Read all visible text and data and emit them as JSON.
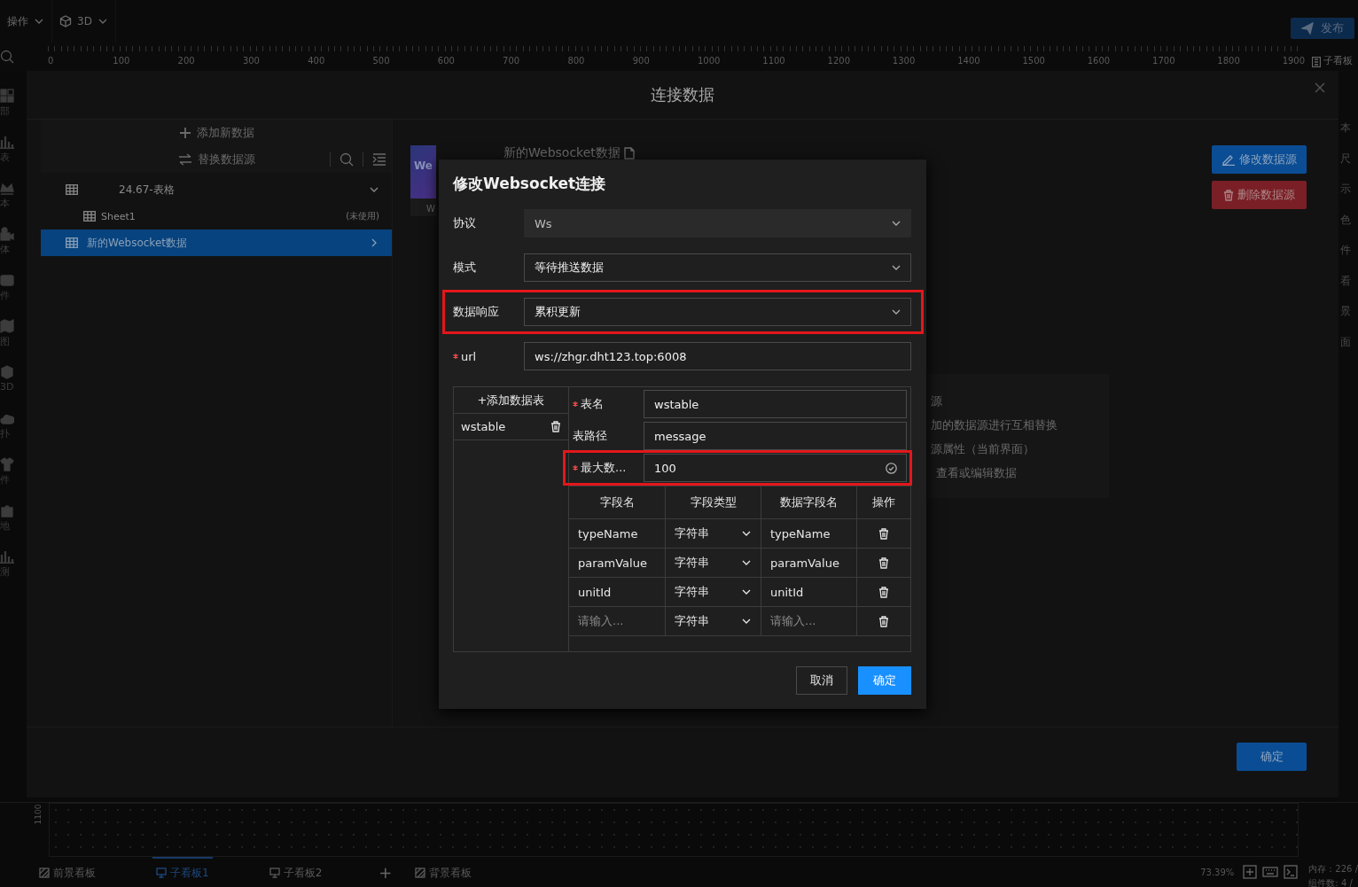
{
  "toolbar": {
    "menus": [
      {
        "label": "操作"
      },
      {
        "label": "3D"
      }
    ],
    "publish_button": "发布"
  },
  "ruler": {
    "ticks": [
      "0",
      "100",
      "200",
      "300",
      "400",
      "500",
      "600",
      "700",
      "800",
      "900",
      "1000",
      "1100",
      "1200",
      "1300",
      "1400",
      "1500",
      "1600",
      "1700",
      "1800",
      "1900"
    ],
    "board_label": "子看板"
  },
  "side_rail": [
    {
      "label": "部"
    },
    {
      "label": "表"
    },
    {
      "label": "本"
    },
    {
      "label": "体"
    },
    {
      "label": "件"
    },
    {
      "label": "图"
    },
    {
      "label": "3D"
    },
    {
      "label": "扑"
    },
    {
      "label": "件"
    },
    {
      "label": "地"
    },
    {
      "label": "测"
    }
  ],
  "right_panel": {
    "rows": [
      "本",
      "尺",
      "示",
      "色",
      "件",
      "看",
      "景",
      "面"
    ]
  },
  "bottom": {
    "timeline_label": "1100",
    "tabs": [
      {
        "kind": "layer",
        "label": "前景看板",
        "selected": false
      },
      {
        "kind": "board",
        "label": "子看板1",
        "selected": true
      },
      {
        "kind": "board",
        "label": "子看板2",
        "selected": false
      },
      {
        "kind": "layer",
        "label": "背景看板",
        "selected": false
      }
    ],
    "add_button": "+",
    "zoom": "73.39%",
    "stats": [
      "内存：226 /",
      "组件数: 4 /"
    ]
  },
  "connect_modal": {
    "title": "连接数据",
    "add_data": "添加新数据",
    "replace_source": "替换数据源",
    "tree": [
      {
        "label": "24.67-表格",
        "expanded": true,
        "selected": false,
        "children": [
          {
            "label": "Sheet1",
            "note": "(未使用)",
            "selected": false
          }
        ]
      },
      {
        "label": "新的Websocket数据",
        "expanded": false,
        "selected": true
      }
    ],
    "thumbnail_text": "We",
    "thumbnail_caption": "W",
    "source_name": "新的Websocket数据",
    "edit_button": "修改数据源",
    "delete_button": "删除数据源",
    "info_lines": [
      "源",
      "加的数据源进行互相替换",
      "源属性（当前界面）",
      "查看或编辑数据"
    ],
    "ok_button": "确定"
  },
  "ws_dialog": {
    "title": "修改Websocket连接",
    "fields": [
      {
        "label": "协议",
        "kind": "select",
        "value": "Ws",
        "disabled": true,
        "required": false,
        "highlighted": false
      },
      {
        "label": "模式",
        "kind": "select",
        "value": "等待推送数据",
        "disabled": false,
        "required": false,
        "highlighted": false
      },
      {
        "label": "数据响应",
        "kind": "select",
        "value": "累积更新",
        "disabled": false,
        "required": false,
        "highlighted": true
      },
      {
        "label": "url",
        "kind": "text",
        "value": "ws://zhgr.dht123.top:6008",
        "disabled": false,
        "required": true,
        "highlighted": false
      }
    ],
    "add_table_button": "+添加数据表",
    "tables": [
      {
        "name": "wstable"
      }
    ],
    "table_fields": [
      {
        "label": "表名",
        "value": "wstable",
        "required": true,
        "highlighted": false,
        "valid": false
      },
      {
        "label": "表路径",
        "value": "message",
        "required": false,
        "highlighted": false,
        "valid": false
      },
      {
        "label": "最大数...",
        "value": "100",
        "required": true,
        "highlighted": true,
        "valid": true
      }
    ],
    "columns": [
      "字段名",
      "字段类型",
      "数据字段名",
      "操作"
    ],
    "rows": [
      {
        "name": {
          "value": "typeName"
        },
        "type": "字符串",
        "data_field": {
          "value": "typeName"
        }
      },
      {
        "name": {
          "value": "paramValue"
        },
        "type": "字符串",
        "data_field": {
          "value": "paramValue"
        }
      },
      {
        "name": {
          "value": "unitId"
        },
        "type": "字符串",
        "data_field": {
          "value": "unitId"
        }
      },
      {
        "name": {
          "placeholder": "请输入..."
        },
        "type": "字符串",
        "data_field": {
          "placeholder": "请输入..."
        }
      }
    ],
    "cancel_button": "取消",
    "ok_button": "确定"
  }
}
